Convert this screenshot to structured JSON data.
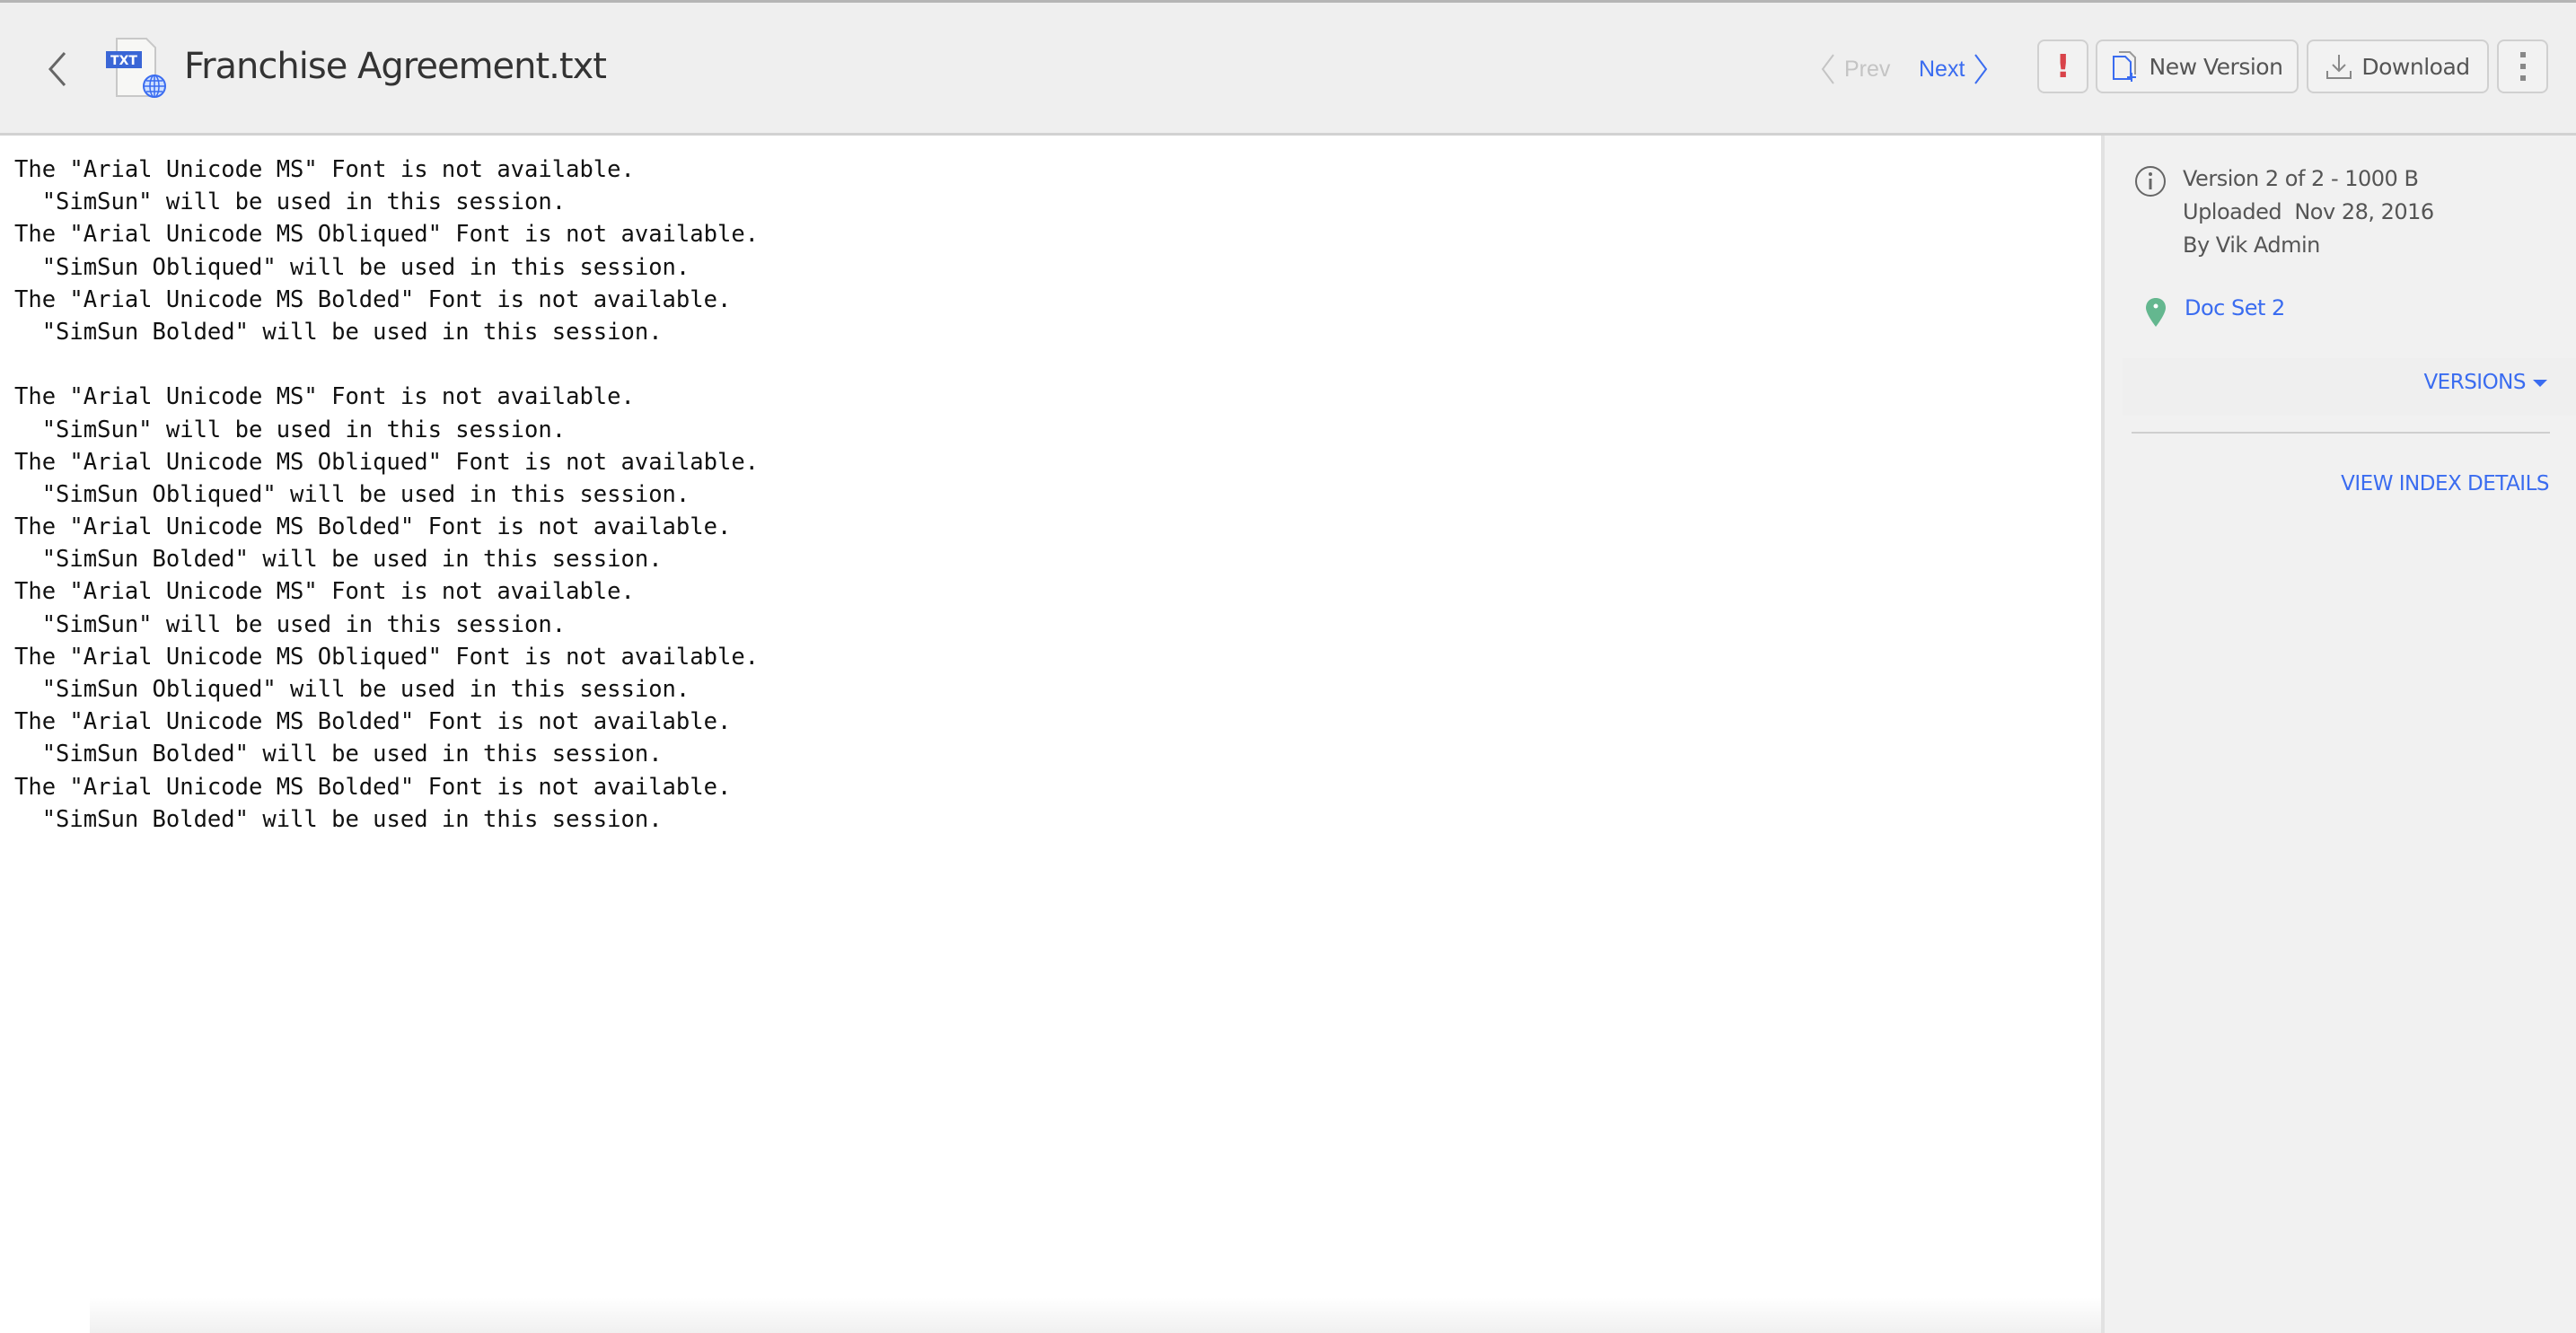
{
  "header": {
    "title": "Franchise Agreement.txt",
    "file_badge": "TXT",
    "prev_label": "Prev",
    "next_label": "Next",
    "alert_label": "!",
    "new_version_label": "New Version",
    "download_label": "Download"
  },
  "document": {
    "lines": [
      "The \"Arial Unicode MS\" Font is not available.",
      "  \"SimSun\" will be used in this session.",
      "The \"Arial Unicode MS Obliqued\" Font is not available.",
      "  \"SimSun Obliqued\" will be used in this session.",
      "The \"Arial Unicode MS Bolded\" Font is not available.",
      "  \"SimSun Bolded\" will be used in this session.",
      "",
      "The \"Arial Unicode MS\" Font is not available.",
      "  \"SimSun\" will be used in this session.",
      "The \"Arial Unicode MS Obliqued\" Font is not available.",
      "  \"SimSun Obliqued\" will be used in this session.",
      "The \"Arial Unicode MS Bolded\" Font is not available.",
      "  \"SimSun Bolded\" will be used in this session.",
      "The \"Arial Unicode MS\" Font is not available.",
      "  \"SimSun\" will be used in this session.",
      "The \"Arial Unicode MS Obliqued\" Font is not available.",
      "  \"SimSun Obliqued\" will be used in this session.",
      "The \"Arial Unicode MS Bolded\" Font is not available.",
      "  \"SimSun Bolded\" will be used in this session.",
      "The \"Arial Unicode MS Bolded\" Font is not available.",
      "  \"SimSun Bolded\" will be used in this session."
    ]
  },
  "sidebar": {
    "version": "Version 2 of 2 - 1000 B",
    "uploaded": "Uploaded  Nov 28, 2016",
    "by": "By Vik Admin",
    "doc_set": "Doc Set 2",
    "versions_label": "VERSIONS",
    "view_index_label": "VIEW INDEX DETAILS"
  },
  "colors": {
    "accent": "#3a6cf0",
    "alert": "#d9434a",
    "pin": "#64b78f"
  }
}
